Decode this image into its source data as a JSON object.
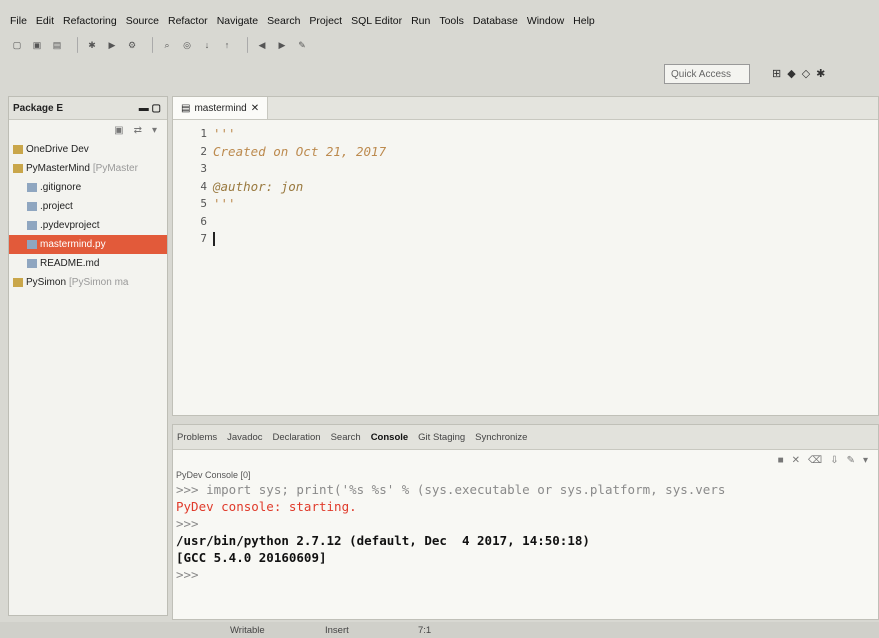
{
  "menu": [
    "File",
    "Edit",
    "Refactoring",
    "Source",
    "Refactor",
    "Navigate",
    "Search",
    "Project",
    "SQL Editor",
    "Run",
    "Tools",
    "Database",
    "Window",
    "Help"
  ],
  "toolbar": {
    "quick_access_placeholder": "Quick Access"
  },
  "package_explorer": {
    "title": "Package E",
    "items": [
      {
        "label": "OneDrive Dev",
        "sub": "",
        "indent": 0,
        "selected": false
      },
      {
        "label": "PyMasterMind",
        "sub": "[PyMaster",
        "indent": 0,
        "selected": false
      },
      {
        "label": ".gitignore",
        "sub": "",
        "indent": 1,
        "selected": false
      },
      {
        "label": ".project",
        "sub": "",
        "indent": 1,
        "selected": false
      },
      {
        "label": ".pydevproject",
        "sub": "",
        "indent": 1,
        "selected": false
      },
      {
        "label": "mastermind.py",
        "sub": "",
        "indent": 1,
        "selected": true
      },
      {
        "label": "README.md",
        "sub": "",
        "indent": 1,
        "selected": false
      },
      {
        "label": "PySimon",
        "sub": "[PySimon ma",
        "indent": 0,
        "selected": false
      }
    ]
  },
  "editor": {
    "tab_label": "mastermind",
    "lines": [
      {
        "num": "1",
        "text": "'''",
        "style": "str"
      },
      {
        "num": "2",
        "text": "Created on Oct 21, 2017",
        "style": "str"
      },
      {
        "num": "3",
        "text": "",
        "style": "str"
      },
      {
        "num": "4",
        "text": "@author: jon",
        "style": "author"
      },
      {
        "num": "5",
        "text": "'''",
        "style": "str"
      },
      {
        "num": "6",
        "text": "",
        "style": "str"
      },
      {
        "num": "7",
        "text": "",
        "style": "caret"
      }
    ]
  },
  "bottom_tabs": [
    "Problems",
    "Javadoc",
    "Declaration",
    "Search",
    "Console",
    "Git Staging",
    "Synchronize"
  ],
  "active_bottom_tab": "Console",
  "console": {
    "label": "PyDev Console [0]",
    "lines": [
      {
        "text": ">>> import sys; print('%s %s' % (sys.executable or sys.platform, sys.vers",
        "style": "prompt"
      },
      {
        "text": "PyDev console: starting.",
        "style": "red"
      },
      {
        "text": ">>>",
        "style": "prompt"
      },
      {
        "text": "/usr/bin/python 2.7.12 (default, Dec  4 2017, 14:50:18)",
        "style": "blk"
      },
      {
        "text": "[GCC 5.4.0 20160609]",
        "style": "blk"
      },
      {
        "text": ">>>",
        "style": "prompt"
      }
    ]
  },
  "status": {
    "writable": "Writable",
    "insert": "Insert",
    "position": "7:1"
  },
  "colors": {
    "selection": "#e25a3a",
    "docstring": "#bc8a4e",
    "console_error": "#e03a2a"
  }
}
